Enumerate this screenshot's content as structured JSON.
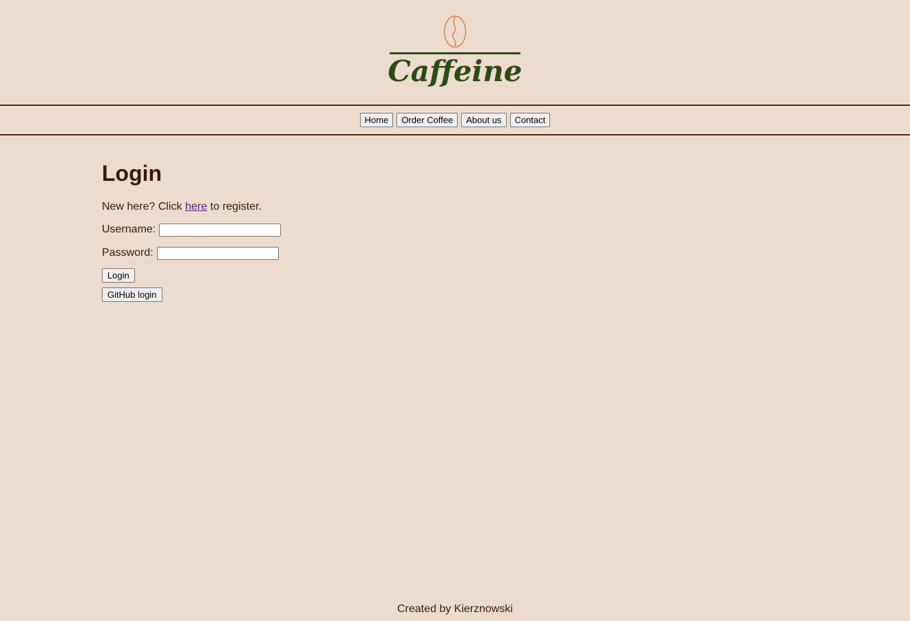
{
  "brand": {
    "name": "Caffeine",
    "icon": "coffee-bean-icon",
    "text_color": "#2b4d12",
    "icon_color": "#e27a3f"
  },
  "nav": {
    "items": [
      {
        "label": "Home"
      },
      {
        "label": "Order Coffee"
      },
      {
        "label": "About us"
      },
      {
        "label": "Contact"
      }
    ]
  },
  "login": {
    "title": "Login",
    "register_prefix": "New here? Click ",
    "register_link": "here",
    "register_suffix": " to register.",
    "username_label": "Username:",
    "username_value": "",
    "password_label": "Password:",
    "password_value": "",
    "login_button": "Login",
    "github_button": "GitHub login"
  },
  "footer": {
    "text": "Created by Kierznowski"
  },
  "colors": {
    "background": "#eddccd",
    "text": "#3a1a05",
    "nav_border": "#5a2d0c",
    "link": "#551a8b"
  }
}
